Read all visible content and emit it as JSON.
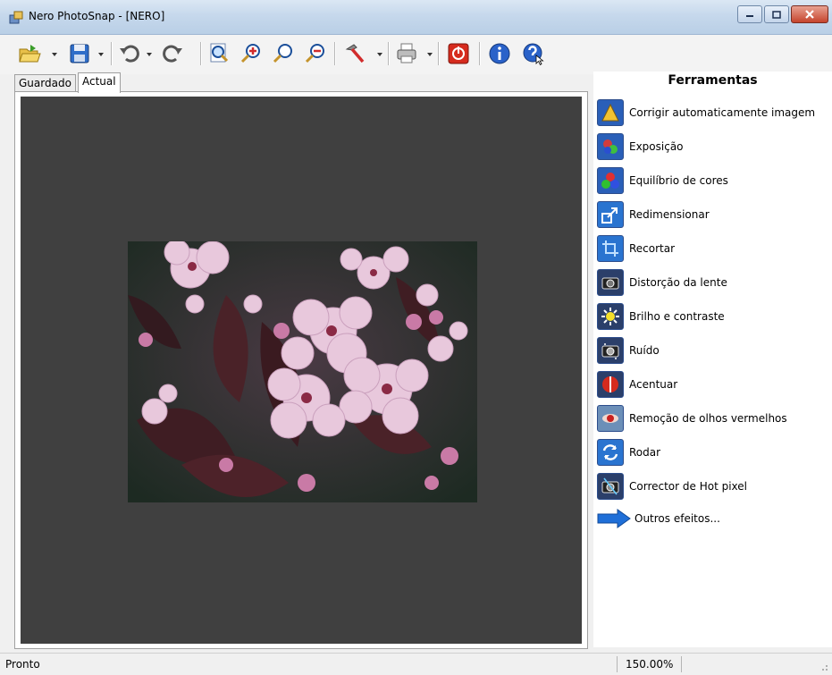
{
  "window": {
    "title": "Nero PhotoSnap - [NERO]"
  },
  "tabs": [
    {
      "label": "Guardado"
    },
    {
      "label": "Actual"
    }
  ],
  "panel": {
    "title": "Ferramentas",
    "tools": [
      {
        "label": "Corrigir automaticamente imagem",
        "icon": "auto-fix-icon"
      },
      {
        "label": "Exposição",
        "icon": "exposure-icon"
      },
      {
        "label": "Equilíbrio de cores",
        "icon": "color-balance-icon"
      },
      {
        "label": "Redimensionar",
        "icon": "resize-icon"
      },
      {
        "label": "Recortar",
        "icon": "crop-icon"
      },
      {
        "label": "Distorção da lente",
        "icon": "lens-distortion-icon"
      },
      {
        "label": "Brilho e contraste",
        "icon": "brightness-contrast-icon"
      },
      {
        "label": "Ruído",
        "icon": "noise-icon"
      },
      {
        "label": "Acentuar",
        "icon": "sharpen-icon"
      },
      {
        "label": "Remoção de olhos vermelhos",
        "icon": "red-eye-icon"
      },
      {
        "label": "Rodar",
        "icon": "rotate-icon"
      },
      {
        "label": "Corrector de Hot pixel",
        "icon": "hot-pixel-icon"
      },
      {
        "label": "Outros efeitos...",
        "icon": "arrow-right-icon"
      }
    ]
  },
  "status": {
    "text": "Pronto",
    "zoom": "150.00%"
  },
  "colors": {
    "canvas": "#404040",
    "titlebar": "#c6d8ec",
    "accent": "#2c6fd0"
  }
}
